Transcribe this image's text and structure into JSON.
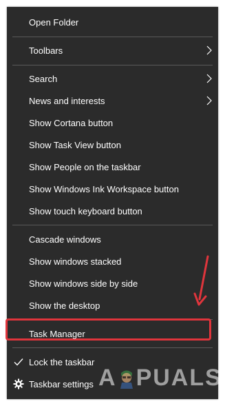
{
  "menu": {
    "items": [
      {
        "label": "Open Folder"
      },
      {
        "label": "Toolbars"
      },
      {
        "label": "Search"
      },
      {
        "label": "News and interests"
      },
      {
        "label": "Show Cortana button"
      },
      {
        "label": "Show Task View button"
      },
      {
        "label": "Show People on the taskbar"
      },
      {
        "label": "Show Windows Ink Workspace button"
      },
      {
        "label": "Show touch keyboard button"
      },
      {
        "label": "Cascade windows"
      },
      {
        "label": "Show windows stacked"
      },
      {
        "label": "Show windows side by side"
      },
      {
        "label": "Show the desktop"
      },
      {
        "label": "Task Manager"
      },
      {
        "label": "Lock the taskbar",
        "checked": true
      },
      {
        "label": "Taskbar settings"
      }
    ]
  },
  "watermark": {
    "text_left": "A",
    "text_right": "PUALS"
  },
  "colors": {
    "menu_bg": "#2b2b2b",
    "separator": "#5a5a5a",
    "highlight": "#e0353c"
  }
}
